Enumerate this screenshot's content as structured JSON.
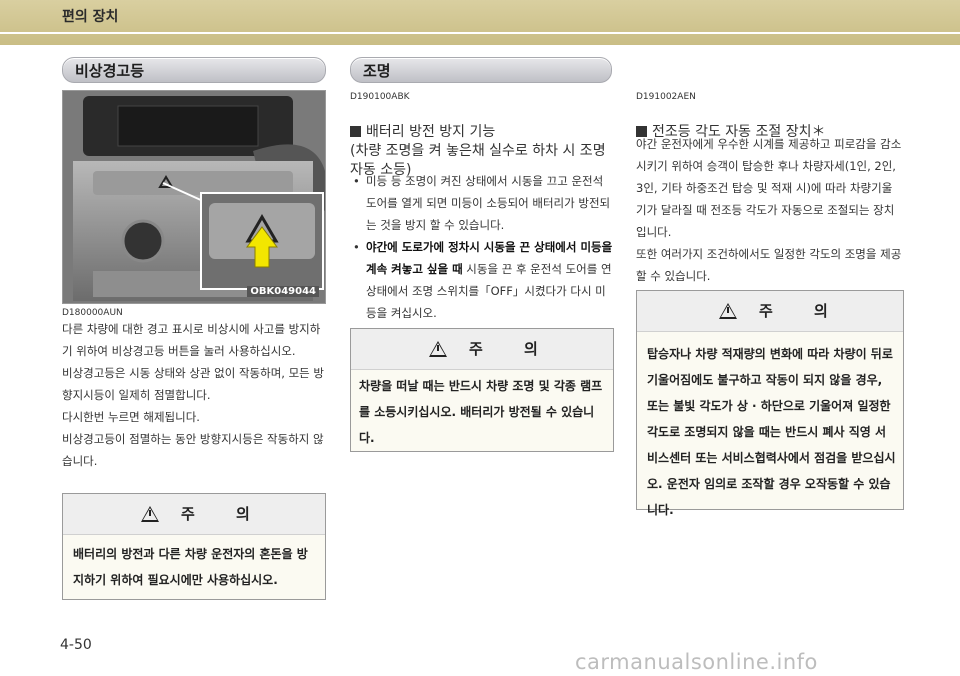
{
  "header": {
    "title": "편의 장치"
  },
  "left": {
    "section_title": "비상경고등",
    "image_label": "OBK049044",
    "code": "D180000AUN",
    "paragraphs": [
      "다른 차량에 대한 경고 표시로 비상시에 사고를 방지하기 위하여 비상경고등 버튼을 눌러 사용하십시오.",
      "비상경고등은 시동 상태와 상관 없이 작동하며, 모든 방향지시등이 일제히 점멸합니다.",
      "다시한번 누르면 해제됩니다.",
      "비상경고등이 점멸하는 동안 방향지시등은 작동하지 않습니다."
    ],
    "caution": {
      "title": "주 의",
      "body": "배터리의 방전과 다른 차량 운전자의 혼돈을 방지하기 위하여 필요시에만 사용하십시오."
    }
  },
  "middle": {
    "section_title": "조명",
    "code": "D190100ABK",
    "heading": "배터리 방전 방지 기능\n(차량 조명을 켜 놓은채 실수로 하차 시 조명 자동 소등)",
    "bullets": [
      {
        "bold": "",
        "text": "미등 등 조명이 켜진 상태에서 시동을 끄고 운전석 도어를 열게 되면 미등이 소등되어 배터리가 방전되는 것을 방지 할 수 있습니다."
      },
      {
        "bold": "야간에 도로가에 정차시 시동을 끈 상태에서 미등을 계속 켜놓고 싶을 때",
        "text": " 시동을 끈 후 운전석 도어를 연 상태에서 조명 스위치를「OFF」시켰다가 다시 미등을 켜십시오."
      }
    ],
    "caution": {
      "title": "주 의",
      "body": "차량을 떠날 때는 반드시 차량 조명 및 각종 램프를 소등시키십시오. 배터리가 방전될 수 있습니다."
    }
  },
  "right": {
    "code": "D191002AEN",
    "heading": "전조등 각도 자동 조절 장치＊",
    "paragraphs": [
      "야간 운전자에게 우수한 시계를 제공하고 피로감을 감소시키기 위하여 승객이 탑승한 후나 차량자세(1인, 2인, 3인, 기타 하중조건 탑승 및 적재 시)에 따라 차량기울기가 달라질 때 전조등 각도가 자동으로 조절되는 장치입니다.",
      "또한 여러가지 조건하에서도 일정한 각도의 조명을 제공할 수 있습니다."
    ],
    "caution": {
      "title": "주 의",
      "body": "탑승자나 차량 적재량의 변화에 따라 차량이 뒤로 기울어짐에도 불구하고 작동이 되지 않을 경우, 또는 불빛 각도가 상 · 하단으로 기울어져 일정한 각도로 조명되지 않을 때는 반드시 폐사 직영 서비스센터 또는 서비스협력사에서 점검을 받으십시오. 운전자 임의로 조작할 경우 오작동할 수 있습니다."
    }
  },
  "footer": {
    "page_number": "4-50",
    "watermark": "carmanualsonline.info"
  },
  "colors": {
    "header_band": "#d3c893",
    "pill": "#d0d1d6",
    "caution_bg": "#fbfaf2",
    "arrow": "#f2e600"
  }
}
